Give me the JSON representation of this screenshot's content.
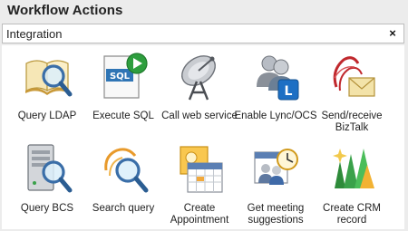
{
  "panel": {
    "title": "Workflow Actions"
  },
  "search": {
    "value": "Integration",
    "clear_label": "×"
  },
  "actions": [
    {
      "label": "Query LDAP",
      "icon": "book-magnifier-icon"
    },
    {
      "label": "Execute SQL",
      "icon": "sql-play-icon"
    },
    {
      "label": "Call web service",
      "icon": "satellite-dish-icon"
    },
    {
      "label": "Enable Lync/OCS",
      "icon": "lync-users-icon"
    },
    {
      "label": "Send/receive BizTalk",
      "icon": "biztalk-envelope-icon"
    },
    {
      "label": "Query BCS",
      "icon": "server-magnifier-icon"
    },
    {
      "label": "Search query",
      "icon": "sharepoint-magnifier-icon"
    },
    {
      "label": "Create Appointment",
      "icon": "calendar-icon"
    },
    {
      "label": "Get meeting suggestions",
      "icon": "meeting-clock-icon"
    },
    {
      "label": "Create CRM record",
      "icon": "crm-bars-icon"
    }
  ]
}
